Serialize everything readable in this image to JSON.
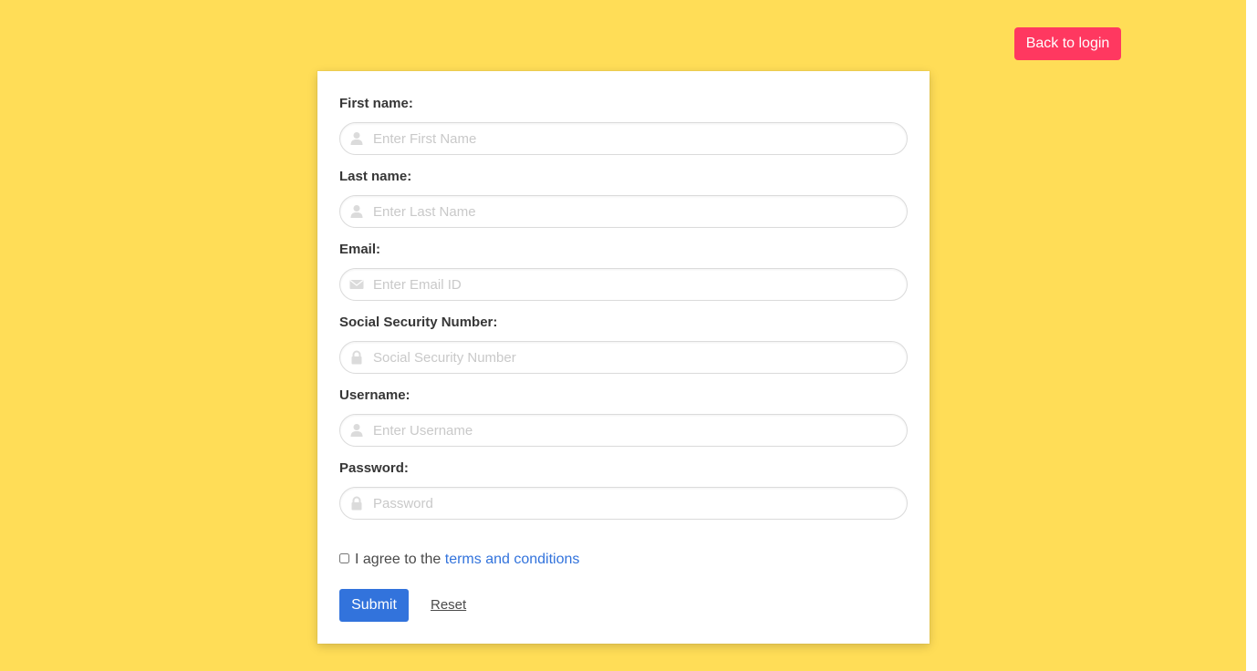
{
  "header": {
    "back_label": "Back to login"
  },
  "form": {
    "fields": [
      {
        "label": "First name:",
        "placeholder": "Enter First Name",
        "value": "",
        "icon": "user-icon"
      },
      {
        "label": "Last name:",
        "placeholder": "Enter Last Name",
        "value": "",
        "icon": "user-icon"
      },
      {
        "label": "Email:",
        "placeholder": "Enter Email ID",
        "value": "",
        "icon": "envelope-icon"
      },
      {
        "label": "Social Security Number:",
        "placeholder": "Social Security Number",
        "value": "",
        "icon": "lock-icon"
      },
      {
        "label": "Username:",
        "placeholder": "Enter Username",
        "value": "",
        "icon": "user-icon"
      },
      {
        "label": "Password:",
        "placeholder": "Password",
        "value": "",
        "icon": "lock-icon"
      }
    ],
    "agree": {
      "prefix": "I agree to the",
      "link_text": "terms and conditions",
      "checked": false
    },
    "submit_label": "Submit",
    "reset_label": "Reset"
  },
  "colors": {
    "background": "#ffdd57",
    "back_button": "#ff3860",
    "submit_button": "#3273dc",
    "link": "#3273dc",
    "icon": "#dbdbdb"
  }
}
